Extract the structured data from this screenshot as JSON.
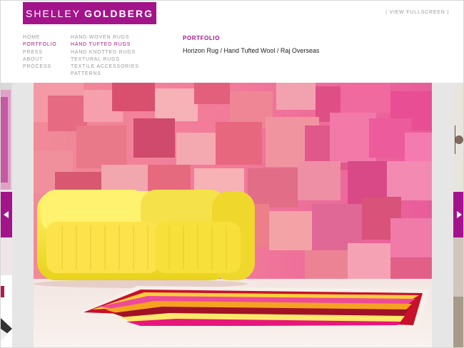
{
  "brand": {
    "first": "SHELLEY",
    "last": "GOLDBERG"
  },
  "fullscreen_label": "| VIEW FULLSCREEN |",
  "nav_main": [
    {
      "label": "HOME",
      "active": false
    },
    {
      "label": "PORTFOLIO",
      "active": true
    },
    {
      "label": "PRESS",
      "active": false
    },
    {
      "label": "ABOUT",
      "active": false
    },
    {
      "label": "PROCESS",
      "active": false
    }
  ],
  "nav_sub": [
    {
      "label": "HAND WOVEN RUGS",
      "active": false
    },
    {
      "label": "HAND TUFTED RUGS",
      "active": true
    },
    {
      "label": "HAND KNOTTED RUGS",
      "active": false
    },
    {
      "label": "TEXTURAL RUGS",
      "active": false
    },
    {
      "label": "TEXTILE ACCESSORIES",
      "active": false
    },
    {
      "label": "PATTERNS",
      "active": false
    }
  ],
  "section_title": "PORTFOLIO",
  "caption": "Horizon Rug / Hand Tufted Wool / Raj Overseas",
  "colors": {
    "accent": "#a3148a",
    "nav_text": "#9a9a9a"
  },
  "icons": {
    "prev": "chevron-left-icon",
    "next": "chevron-right-icon"
  }
}
